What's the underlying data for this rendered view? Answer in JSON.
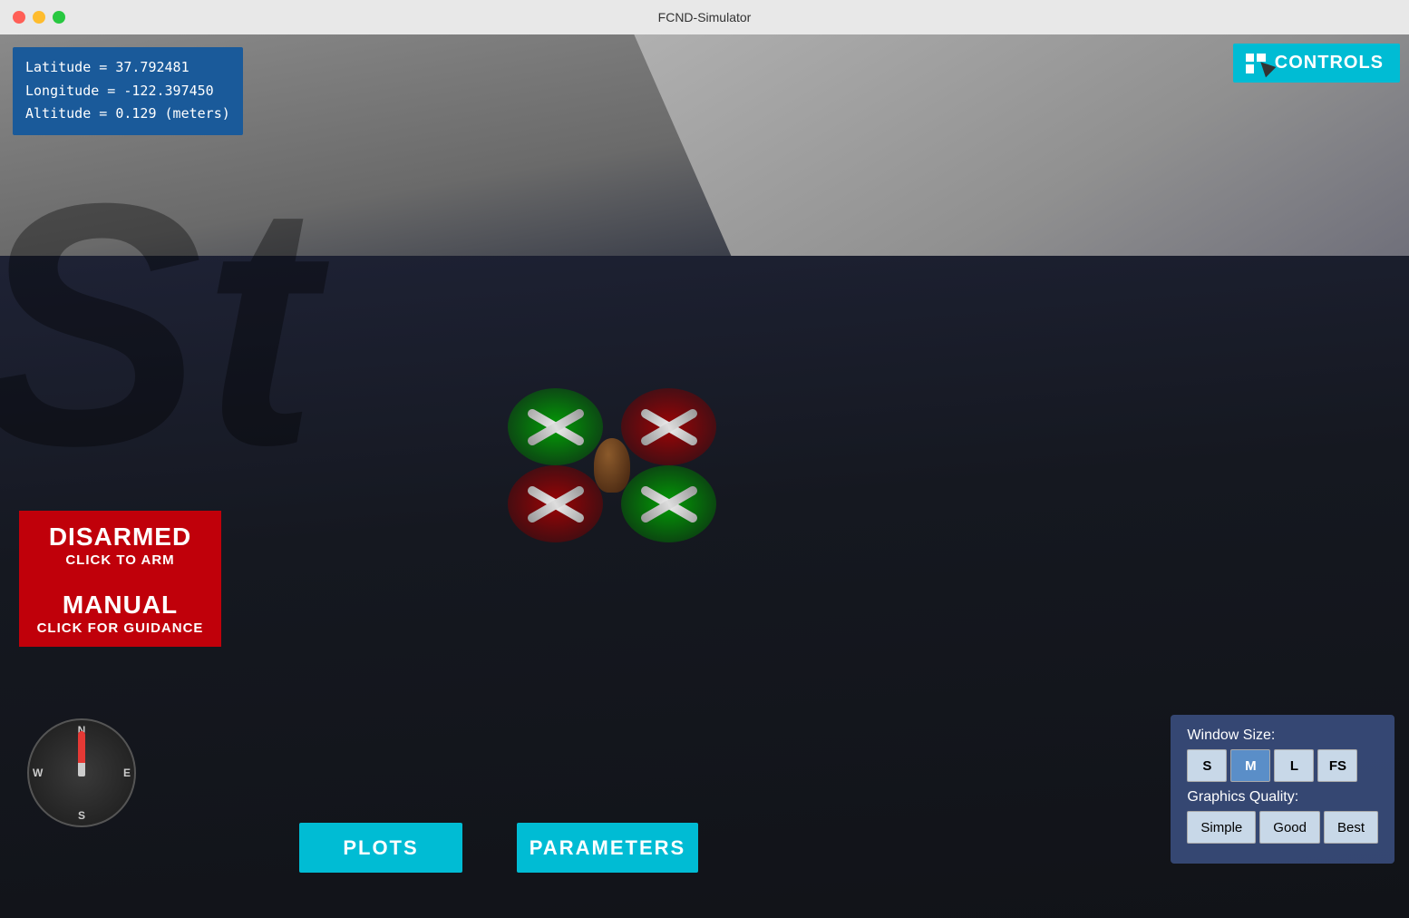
{
  "titlebar": {
    "title": "FCND-Simulator"
  },
  "telemetry": {
    "latitude_label": "Latitude = 37.792481",
    "longitude_label": "Longitude = -122.397450",
    "altitude_label": "Altitude = 0.129 (meters)"
  },
  "controls_button": {
    "label": "CONTROLS"
  },
  "arm_button": {
    "main": "DISARMED",
    "sub": "CLICK TO ARM"
  },
  "mode_button": {
    "main": "MANUAL",
    "sub": "CLICK FOR GUIDANCE"
  },
  "compass": {
    "n": "N",
    "s": "S",
    "e": "E",
    "w": "W"
  },
  "bottom_buttons": {
    "plots": "PLOTS",
    "parameters": "PARAMETERS"
  },
  "settings": {
    "window_size_label": "Window Size:",
    "sizes": [
      "S",
      "M",
      "L",
      "FS"
    ],
    "graphics_quality_label": "Graphics Quality:",
    "qualities": [
      "Simple",
      "Good",
      "Best"
    ]
  },
  "watermark": "St"
}
